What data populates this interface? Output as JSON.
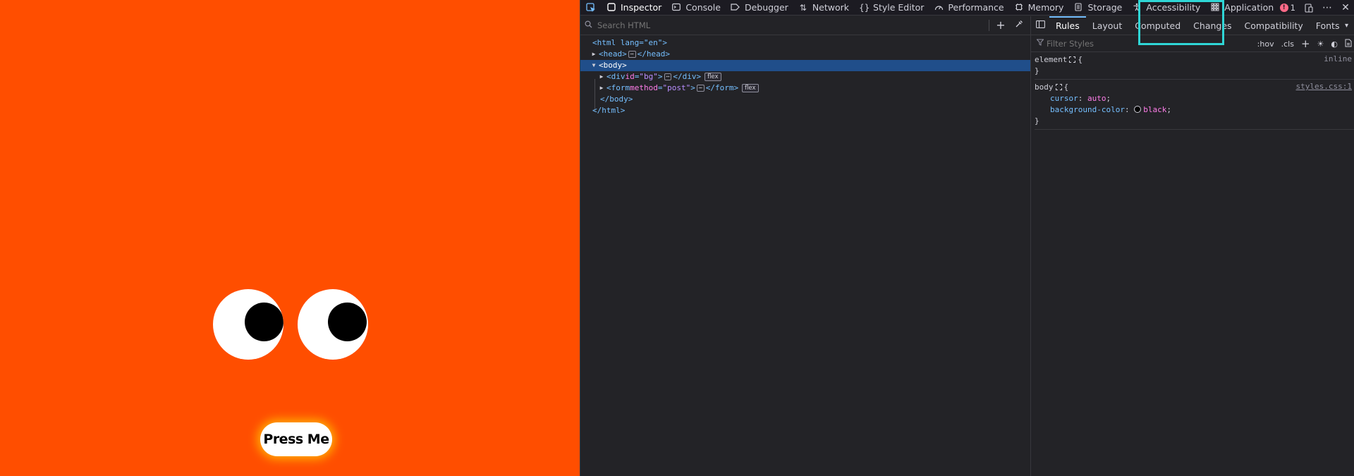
{
  "page": {
    "background": "#ff4e00",
    "button_label": "Press Me",
    "button_glow": "#ffb000"
  },
  "devtools": {
    "tabs": [
      {
        "label": "Inspector",
        "icon": "inspector-icon",
        "active": true
      },
      {
        "label": "Console",
        "icon": "console-icon"
      },
      {
        "label": "Debugger",
        "icon": "debugger-icon"
      },
      {
        "label": "Network",
        "icon": "network-icon"
      },
      {
        "label": "Style Editor",
        "icon": "style-editor-icon"
      },
      {
        "label": "Performance",
        "icon": "performance-icon"
      },
      {
        "label": "Memory",
        "icon": "memory-icon"
      },
      {
        "label": "Storage",
        "icon": "storage-icon"
      },
      {
        "label": "Accessibility",
        "icon": "accessibility-icon"
      },
      {
        "label": "Application",
        "icon": "application-icon"
      }
    ],
    "error_count": "1",
    "search_placeholder": "Search HTML",
    "tree": {
      "html_open": "<html lang=\"en\">",
      "head": "<head>",
      "head_close": "</head>",
      "body": "<body>",
      "div_open": "<div ",
      "div_attr_name": "id",
      "div_attr_value": "\"bg\"",
      "div_close": "</div>",
      "form_open": "<form ",
      "form_attr_name": "method",
      "form_attr_value": "\"post\"",
      "form_close": "</form>",
      "flex_badge": "flex",
      "body_close": "</body>",
      "html_close": "</html>"
    },
    "sidebar": {
      "tabs": [
        "Rules",
        "Layout",
        "Computed",
        "Changes",
        "Compatibility",
        "Fonts"
      ],
      "active_tab": "Rules",
      "filter_placeholder": "Filter Styles",
      "hov": ":hov",
      "cls": ".cls",
      "rules": {
        "element_selector": "element",
        "element_source": "inline",
        "body_selector": "body",
        "body_source": "styles.css:1",
        "prop1_name": "cursor",
        "prop1_value": "auto",
        "prop2_name": "background-color",
        "prop2_value": "black"
      }
    },
    "accent": "#75bfff",
    "selection": "#204e8a",
    "highlight_box": "#2fd6d6"
  }
}
